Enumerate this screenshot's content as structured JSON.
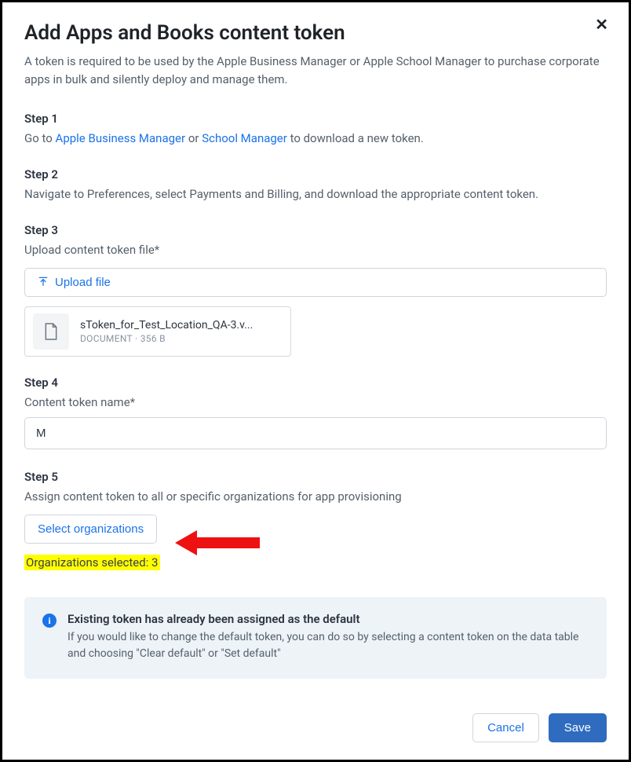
{
  "title": "Add Apps and Books content token",
  "subtitle": "A token is required to be used by the Apple Business Manager or Apple School Manager to purchase corporate apps in bulk and silently deploy and manage them.",
  "close_label": "✕",
  "step1": {
    "heading": "Step 1",
    "prefix": "Go to ",
    "link1": "Apple Business Manager",
    "joiner": " or ",
    "link2": "School Manager",
    "suffix": " to download a new token."
  },
  "step2": {
    "heading": "Step 2",
    "body": "Navigate to Preferences, select Payments and Billing, and download the appropriate content token."
  },
  "step3": {
    "heading": "Step 3",
    "label": "Upload content token file*",
    "button_label": "Upload file",
    "file_name": "sToken_for_Test_Location_QA-3.v...",
    "file_type": "DOCUMENT",
    "file_size": "356 B"
  },
  "step4": {
    "heading": "Step 4",
    "label": "Content token name*",
    "value": "M"
  },
  "step5": {
    "heading": "Step 5",
    "label": "Assign content token to all or specific organizations for app provisioning",
    "button_label": "Select organizations",
    "orgs_selected_text": "Organizations selected: 3"
  },
  "info": {
    "title": "Existing token has already been assigned as the default",
    "body": "If you would like to change the default token, you can do so by selecting a content token on the data table and choosing \"Clear default\" or \"Set default\""
  },
  "footer": {
    "cancel": "Cancel",
    "save": "Save"
  }
}
